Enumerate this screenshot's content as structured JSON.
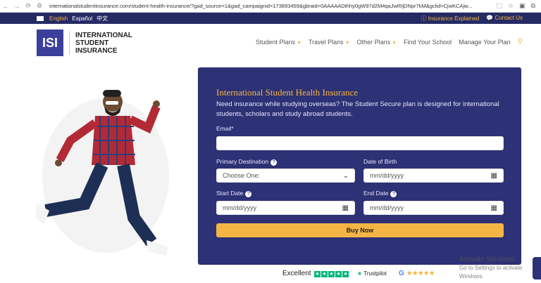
{
  "browser": {
    "url": "internationalstudentinsurance.com/student-health-insurance/?gad_source=1&gad_campaignid=173893459&gbraid=0AAAAADthhy0gW97d2M4qaJwRIjDNpr7kM&gclid=CjwKCAjw..."
  },
  "topbar": {
    "languages": [
      "English",
      "Español",
      "中文"
    ],
    "links": [
      "Insurance Explained",
      "Contact Us"
    ]
  },
  "header": {
    "logo_mark": "ISI",
    "logo_lines": [
      "INTERNATIONAL",
      "STUDENT",
      "INSURANCE"
    ],
    "nav": [
      {
        "label": "Student Plans"
      },
      {
        "label": "Travel Plans"
      },
      {
        "label": "Other Plans"
      },
      {
        "label": "Find Your School"
      },
      {
        "label": "Manage Your Plan"
      }
    ]
  },
  "form": {
    "title": "International Student Health Insurance",
    "description": "Need insurance while studying overseas? The Student Secure plan is designed for international students, scholars and study abroad students.",
    "email_label": "Email*",
    "primary_destination_label": "Primary Destination",
    "primary_destination_value": "Choose One:",
    "dob_label": "Date of Birth",
    "date_placeholder": "mm/dd/yyyy",
    "start_label": "Start Date",
    "end_label": "End Date",
    "buy_label": "Buy Now"
  },
  "ratings": {
    "excellent": "Excellent",
    "trustpilot": "Trustpilot"
  },
  "watermark": {
    "title": "Activate Windows",
    "subtitle": "Go to Settings to activate Windows."
  },
  "colors": {
    "navy": "#242a63",
    "card": "#2d3175",
    "accent": "#f5b544",
    "trustpilot": "#00b67a"
  }
}
